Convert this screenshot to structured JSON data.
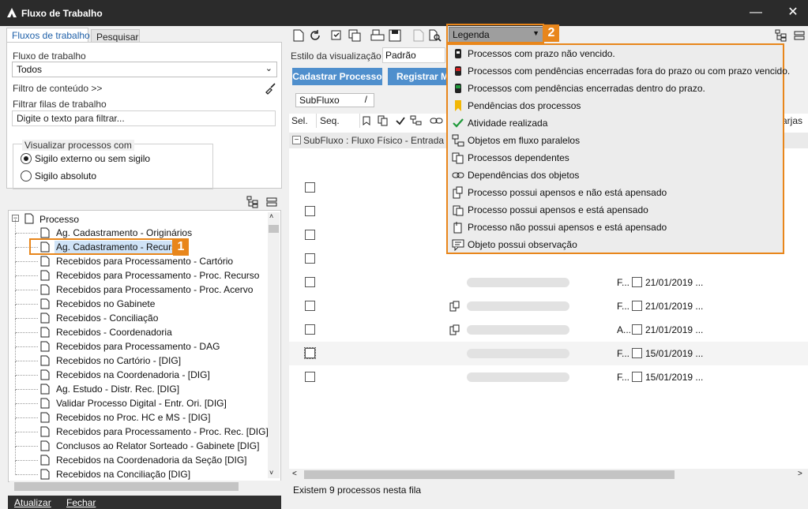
{
  "window": {
    "title": "Fluxo de Trabalho",
    "minimize": "—",
    "close": "✕"
  },
  "left": {
    "tabs": [
      "Fluxos de trabalho",
      "Pesquisar"
    ],
    "workflow_label": "Fluxo de trabalho",
    "workflow_value": "Todos",
    "content_filter": "Filtro de conteúdo >>",
    "queue_filter_label": "Filtrar filas de trabalho",
    "queue_filter_placeholder": "Digite o texto para filtrar...",
    "visualize_label": "Visualizar processos com",
    "radio_options": [
      "Sigilo externo ou sem sigilo",
      "Sigilo absoluto"
    ],
    "radio_selected": 0,
    "tree_root": "Processo",
    "tree_items": [
      "Ag. Cadastramento - Originários",
      "Ag. Cadastramento - Recurso",
      "Recebidos para Processamento - Cartório",
      "Recebidos para Processamento - Proc. Recurso",
      "Recebidos para Processamento - Proc. Acervo",
      "Recebidos no Gabinete",
      "Recebidos - Conciliação",
      "Recebidos - Coordenadoria",
      "Recebidos para Processamento - DAG",
      "Recebidos no Cartório - [DIG]",
      "Recebidos na Coordenadoria - [DIG]",
      "Ag. Estudo - Distr. Rec. [DIG]",
      "Validar Processo Digital - Entr. Ori. [DIG]",
      "Recebidos no Proc. HC e MS - [DIG]",
      "Recebidos para Processamento - Proc. Rec. [DIG]",
      "Conclusos ao Relator Sorteado - Gabinete [DIG]",
      "Recebidos na Coordenadoria da Seção [DIG]",
      "Recebidos na Conciliação [DIG]"
    ],
    "tree_selected": 1,
    "badge1": "1",
    "refresh": "Atualizar",
    "close": "Fechar"
  },
  "right": {
    "legend_label": "Legenda",
    "badge2": "2",
    "view_style_label": "Estilo da visualização",
    "view_style_value": "Padrão",
    "btn_register": "Cadastrar Processo",
    "btn_register2": "Registrar M",
    "subflow_value": "SubFluxo",
    "columns": {
      "sel": "Sel.",
      "seq": "Seq.",
      "right_cut": "arjas"
    },
    "group_row": "SubFluxo : Fluxo Físico - Entrada e",
    "rows": [
      {
        "code": "F...",
        "date": "21/01/2019 ..."
      },
      {
        "code": "F...",
        "date": "21/01/2019 ..."
      },
      {
        "code": "A...",
        "date": "21/01/2019 ..."
      },
      {
        "code": "F...",
        "date": "15/01/2019 ..."
      },
      {
        "code": "F...",
        "date": "15/01/2019 ..."
      }
    ],
    "status": "Existem 9 processos nesta fila",
    "legend_items": [
      {
        "icon": "lock-black-icon",
        "text": "Processos com prazo não vencido."
      },
      {
        "icon": "lock-red-icon",
        "text": "Processos com pendências encerradas fora do prazo ou com prazo vencido."
      },
      {
        "icon": "lock-green-icon",
        "text": "Processos com pendências encerradas dentro do prazo."
      },
      {
        "icon": "bookmark-icon",
        "text": "Pendências dos processos"
      },
      {
        "icon": "checkmark-icon",
        "text": "Atividade realizada"
      },
      {
        "icon": "parallel-flow-icon",
        "text": "Objetos em fluxo paralelos"
      },
      {
        "icon": "dependent-process-icon",
        "text": "Processos dependentes"
      },
      {
        "icon": "link-icon",
        "text": "Dependências dos objetos"
      },
      {
        "icon": "has-attachments-not-attached-icon",
        "text": "Processo possui apensos e não está apensado"
      },
      {
        "icon": "has-attachments-attached-icon",
        "text": "Processo possui apensos e está apensado"
      },
      {
        "icon": "no-attachments-attached-icon",
        "text": "Processo não possui apensos e está apensado"
      },
      {
        "icon": "comment-icon",
        "text": "Objeto possui observação"
      }
    ],
    "colors": {
      "accent_orange": "#e8861b",
      "button_blue": "#4f8fcd",
      "lock_red": "#d21f1f",
      "lock_green": "#1f9a3a",
      "bookmark": "#f2b705",
      "check": "#1f9a3a"
    }
  }
}
